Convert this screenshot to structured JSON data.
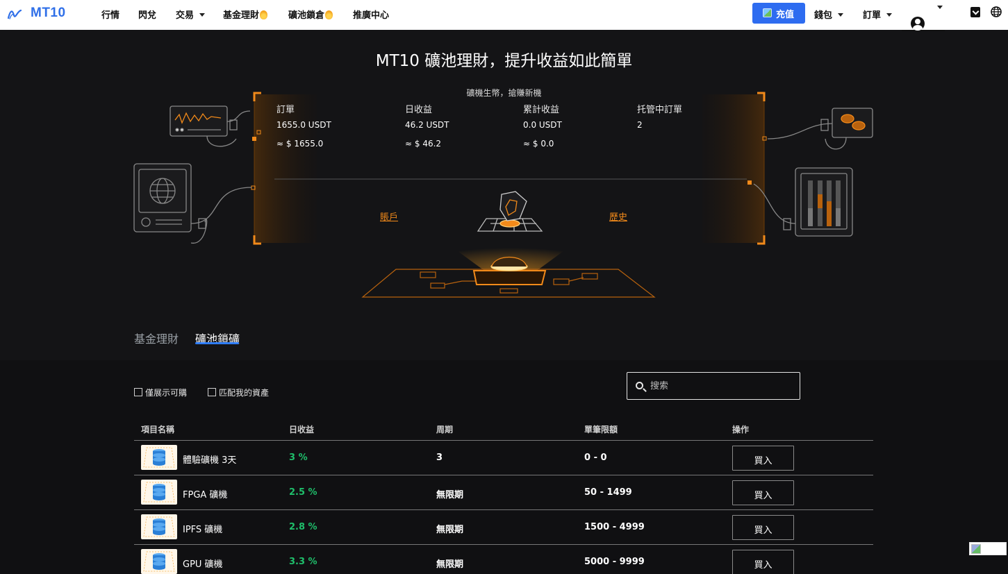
{
  "nav": {
    "brand": "MT10",
    "items": [
      {
        "label": "行情"
      },
      {
        "label": "閃兌"
      },
      {
        "label": "交易"
      },
      {
        "label": "基金理財"
      },
      {
        "label": "礦池鎖倉"
      },
      {
        "label": "推廣中心"
      }
    ],
    "recharge": "充值",
    "wallet": "錢包",
    "orders": "訂單"
  },
  "hero": {
    "title": "MT10 礦池理財，提升收益如此簡單",
    "subtitle": "礦機生幣，搶賺新機",
    "stats": [
      {
        "label": "訂單",
        "value": "1655.0 USDT",
        "usd": "≈ $ 1655.0"
      },
      {
        "label": "日收益",
        "value": "46.2 USDT",
        "usd": "≈ $ 46.2"
      },
      {
        "label": "累計收益",
        "value": "0.0 USDT",
        "usd": "≈ $ 0.0"
      },
      {
        "label": "托管中訂單",
        "value": "2",
        "usd": ""
      }
    ],
    "account_link": "賬戶",
    "history_link": "歷史"
  },
  "tabs": [
    {
      "label": "基金理財",
      "active": false
    },
    {
      "label": "礦池鎖礦",
      "active": true
    }
  ],
  "filters": {
    "only_buyable": "僅展示可購",
    "match_assets": "匹配我的資產",
    "search_placeholder": "搜索"
  },
  "table": {
    "headers": [
      "項目名稱",
      "日收益",
      "周期",
      "單筆限額",
      "操作"
    ],
    "rows": [
      {
        "name": "體驗礦機 3天",
        "rate": "3 %",
        "period": "3",
        "limit": "0 - 0",
        "action": "買入"
      },
      {
        "name": "FPGA 礦機",
        "rate": "2.5 %",
        "period": "無限期",
        "limit": "50 - 1499",
        "action": "買入"
      },
      {
        "name": "IPFS 礦機",
        "rate": "2.8 %",
        "period": "無限期",
        "limit": "1500 - 4999",
        "action": "買入"
      },
      {
        "name": "GPU 礦機",
        "rate": "3.3 %",
        "period": "無限期",
        "limit": "5000 - 9999",
        "action": "買入"
      }
    ]
  },
  "colors": {
    "accent": "#2e6cf0",
    "orange": "#f28a1a",
    "positive": "#1fbf6b",
    "background": "#141416"
  }
}
